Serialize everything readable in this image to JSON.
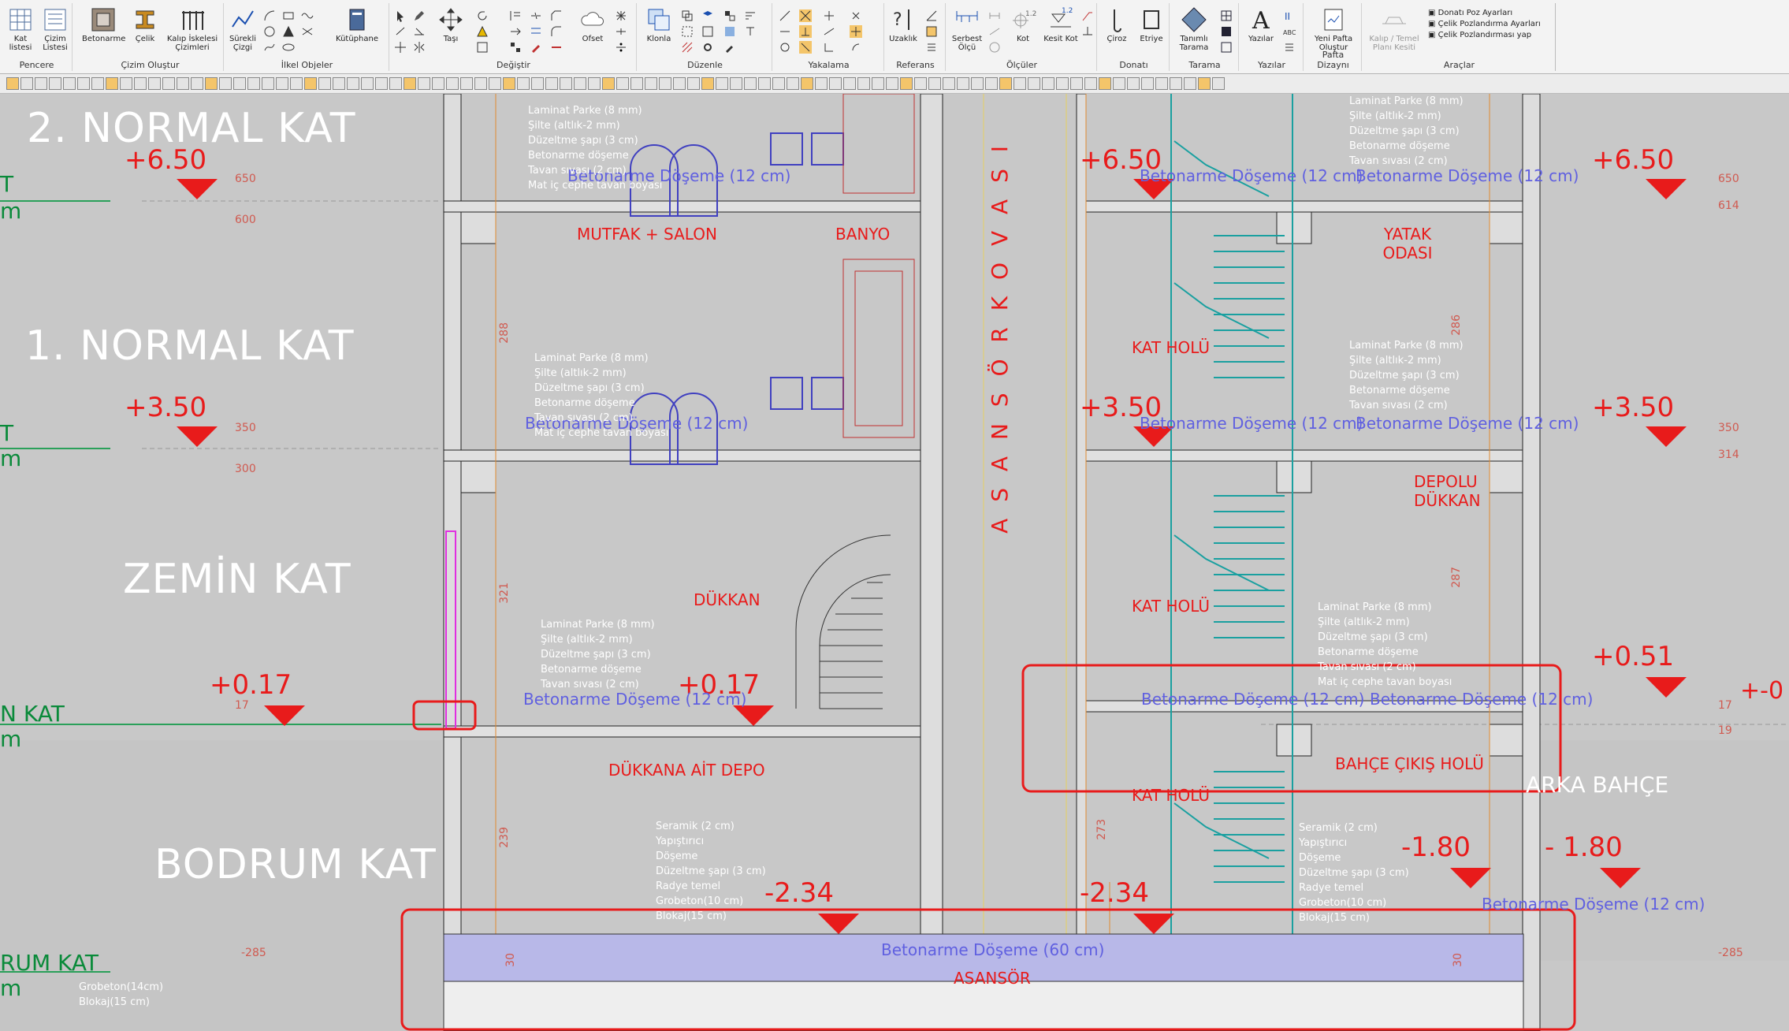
{
  "ribbon": {
    "groups": [
      {
        "name": "Pencere",
        "buttons": [
          "Kat listesi",
          "Çizim Listesi"
        ]
      },
      {
        "name": "Çizim Oluştur",
        "buttons": [
          "Betonarme",
          "Çelik",
          "Kalıp İskelesi Çizimleri"
        ]
      },
      {
        "name": "İlkel Objeler",
        "buttons": [
          "Sürekli Çizgi",
          "Kütüphane"
        ]
      },
      {
        "name": "Değiştir",
        "buttons": [
          "Taşı",
          "Ofset"
        ]
      },
      {
        "name": "Düzenle",
        "buttons": [
          "Klonla"
        ]
      },
      {
        "name": "Yakalama",
        "buttons": []
      },
      {
        "name": "Referans",
        "buttons": [
          "Uzaklık"
        ]
      },
      {
        "name": "Ölçüler",
        "buttons": [
          "Serbest Ölçü",
          "Kot",
          "Kesit Kot"
        ]
      },
      {
        "name": "Donatı",
        "buttons": [
          "Çiroz",
          "Etriye"
        ]
      },
      {
        "name": "Tarama",
        "buttons": [
          "Tanımlı Tarama"
        ]
      },
      {
        "name": "Yazılar",
        "buttons": [
          "Yazılar"
        ]
      },
      {
        "name": "Pafta Dizaynı",
        "buttons": [
          "Yeni Pafta Oluştur"
        ]
      },
      {
        "name": "Araçlar",
        "buttons": [
          "Kalıp / Temel Planı Kesiti"
        ]
      }
    ],
    "tools_list": [
      "Donatı Poz Ayarları",
      "Çelik Pozlandırma Ayarları",
      "Çelik Pozlandırması yap"
    ],
    "kot_values": {
      "kot": "1.2",
      "kesit": "1.2"
    }
  },
  "drawing": {
    "floors": [
      "2. NORMAL KAT",
      "1. NORMAL KAT",
      "ZEMİN KAT",
      "BODRUM KAT"
    ],
    "levels": [
      "+6.50",
      "+3.50",
      "+0.17",
      "-2.34",
      "+0.51",
      "-1.80",
      "- 1.80"
    ],
    "rooms": [
      "MUTFAK + SALON",
      "BANYO",
      "DÜKKAN",
      "DÜKKANA AİT DEPO",
      "YATAK ODASI",
      "KAT HOLÜ",
      "DEPOLU DÜKKAN",
      "BAHÇE ÇIKIŞ HOLÜ",
      "ARKA BAHÇE",
      "ASANSÖR"
    ],
    "elevator_text": "A S A N S Ö R   K O V A S I",
    "slab_12": "Betonarme Döşeme (12 cm)",
    "slab_60": "Betonarme Döşeme (60 cm)",
    "layers_floor": [
      "Laminat Parke (8 mm)",
      "Şilte (altlık-2 mm)",
      "Düzeltme şapı (3 cm)",
      "Betonarme döşeme",
      "Tavan sıvası (2 cm)",
      "Mat iç cephe tavan boyası"
    ],
    "layers_base": [
      "Seramik (2 cm)",
      "Yapıştırıcı",
      "Döşeme",
      "Düzeltme şapı (3 cm)",
      "Radye temel",
      "Grobeton(10 cm)",
      "Blokaj(15 cm)"
    ],
    "ground_layers": [
      "Grobeton(14cm)",
      "Blokaj(15 cm)"
    ],
    "dims": [
      "650",
      "600",
      "350",
      "300",
      "17",
      "288",
      "321",
      "239",
      "273",
      "287",
      "286",
      "614",
      "314",
      "19",
      "-285",
      "30"
    ],
    "left_labels": [
      "T",
      "m",
      "N KAT",
      "RUM KAT"
    ],
    "right_edge": "+-0"
  }
}
